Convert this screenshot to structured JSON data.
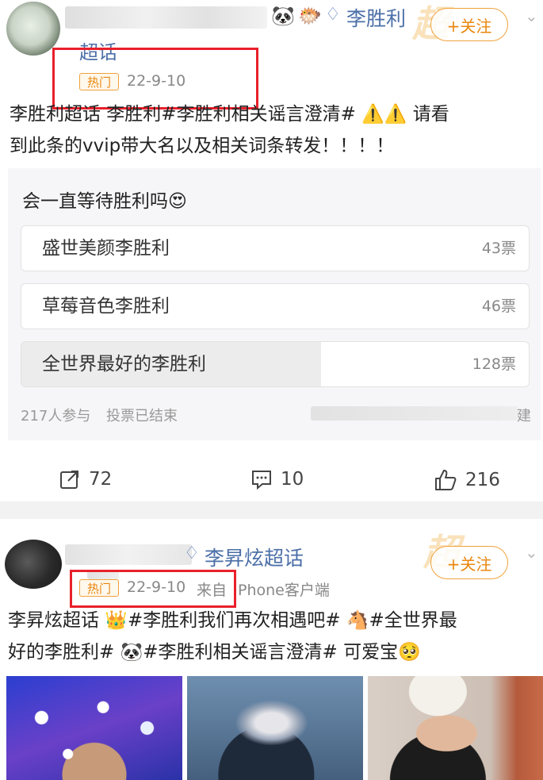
{
  "post1": {
    "topic_link": "李胜利",
    "follow_label": "+关注",
    "superchat_label": "超话",
    "hot_badge": "热门",
    "date": "22-9-10",
    "text_line1": "李胜利超话 李胜利#李胜利相关谣言澄清# ⚠️⚠️ 请看",
    "text_line2": "到此条的vvip带大名以及相关词条转发！！！！",
    "poll": {
      "question": "会一直等待胜利吗😍",
      "options": [
        {
          "label": "盛世美颜李胜利",
          "votes": "43票",
          "count": 43
        },
        {
          "label": "草莓音色李胜利",
          "votes": "46票",
          "count": 46
        },
        {
          "label": "全世界最好的李胜利",
          "votes": "128票",
          "count": 128
        }
      ],
      "participants": "217人参与",
      "status": "投票已结束",
      "corner_char": "建"
    },
    "actions": {
      "repost": "72",
      "comment": "10",
      "like": "216"
    }
  },
  "post2": {
    "topic_link": "李昇炫超话",
    "follow_label": "+关注",
    "hot_badge": "热门",
    "date": "22-9-10",
    "source_prefix": "来自",
    "source": "Phone客户端",
    "text_line1": "李昇炫超话 👑#李胜利我们再次相遇吧# 🐴#全世界最",
    "text_line2": "好的李胜利# 🐼#李胜利相关谣言澄清# 可爱宝🥺"
  },
  "colors": {
    "link": "#4b6fa8",
    "accent": "#e9870f",
    "highlight_box": "#e8202b"
  }
}
